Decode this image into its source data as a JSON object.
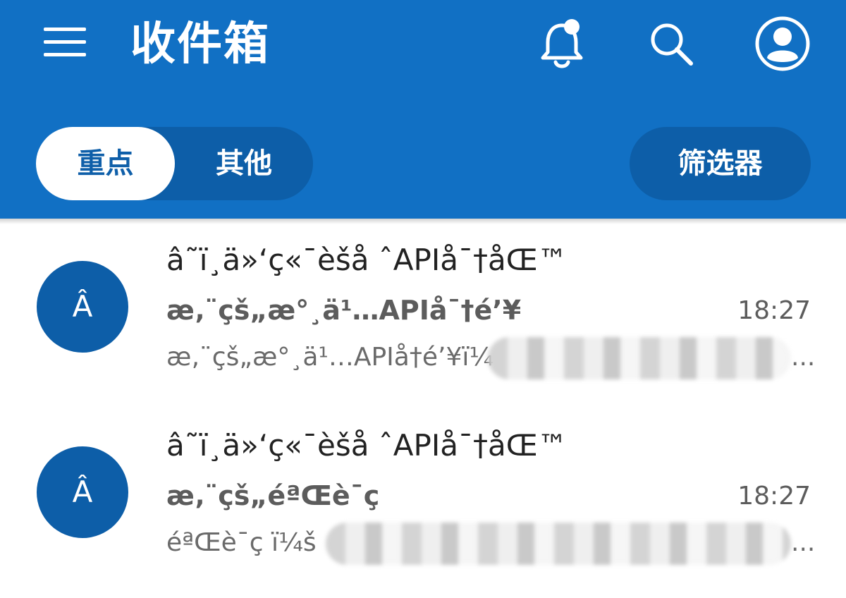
{
  "header": {
    "title": "收件箱",
    "menu_icon": "hamburger-menu-icon",
    "bell_icon": "bell-notification-icon",
    "search_icon": "search-icon",
    "avatar_icon": "account-avatar-icon",
    "background_color": "#1170c4"
  },
  "tabs": {
    "focused_label": "重点",
    "other_label": "其他",
    "selected": "重点"
  },
  "filter": {
    "label": "筛选器"
  },
  "mails": [
    {
      "avatar_letter": "Â",
      "title": "â˜ï¸ä»‘ç«¯èšå ˆAPIå¯†åŒ™",
      "sender": "æ‚¨çš„æ°¸ä¹…APIå¯†é’¥",
      "time": "18:27",
      "preview": "æ‚¨çš„æ°¸ä¹…APIå†é’¥ï¼",
      "preview_tail": "..."
    },
    {
      "avatar_letter": "Â",
      "title": "â˜ï¸ä»‘ç«¯èšå ˆAPIå¯†åŒ™",
      "sender": "æ‚¨çš„éªŒè¯ç ",
      "time": "18:27",
      "preview": "éªŒè¯ç ï¼š",
      "preview_tail": "..."
    }
  ]
}
